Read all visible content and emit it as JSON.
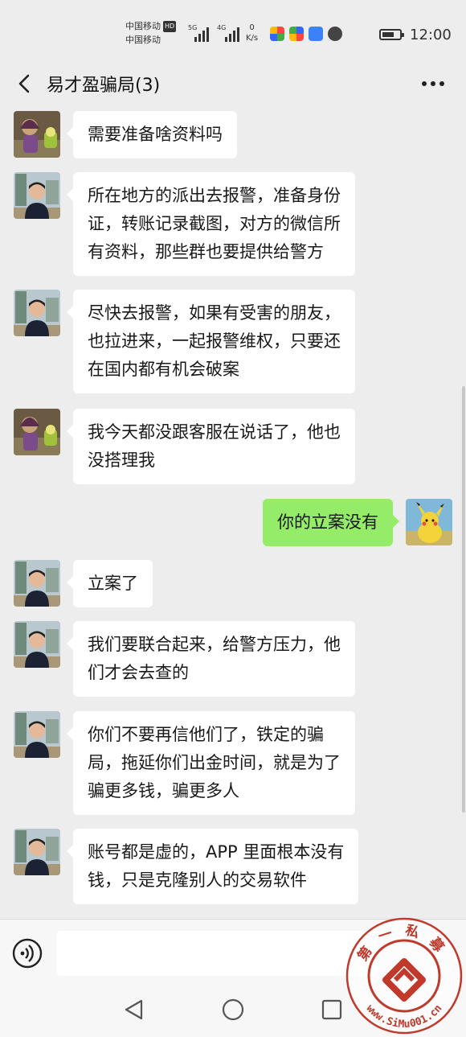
{
  "status": {
    "carrier1": "中国移动",
    "carrier1_badge": "HD",
    "carrier2": "中国移动",
    "net1": "5G",
    "net2": "4G",
    "speed_value": "0",
    "speed_unit": "K/s",
    "battery_level": 0.7,
    "time": "12:00"
  },
  "header": {
    "title": "易才盈骗局(3)",
    "back_icon": "chevron-left-icon",
    "more_icon": "more-dots-icon"
  },
  "messages": [
    {
      "side": "left",
      "avatar": "avatar-woman",
      "lines": [
        "需要准备啥资料吗"
      ]
    },
    {
      "side": "left",
      "avatar": "avatar-man",
      "lines": [
        "所在地方的派出去报警，准备身份",
        "证，转账记录截图，对方的微信所",
        "有资料，那些群也要提供给警方"
      ]
    },
    {
      "side": "left",
      "avatar": "avatar-man",
      "lines": [
        "尽快去报警，如果有受害的朋友，",
        "也拉进来，一起报警维权，只要还",
        "在国内都有机会破案"
      ]
    },
    {
      "side": "left",
      "avatar": "avatar-woman",
      "lines": [
        "我今天都没跟客服在说话了，他也",
        "没搭理我"
      ]
    },
    {
      "side": "right",
      "avatar": "avatar-pikachu",
      "lines": [
        "你的立案没有"
      ]
    },
    {
      "side": "left",
      "avatar": "avatar-man",
      "lines": [
        "立案了"
      ]
    },
    {
      "side": "left",
      "avatar": "avatar-man",
      "lines": [
        "我们要联合起来，给警方压力，他",
        "们才会去查的"
      ]
    },
    {
      "side": "left",
      "avatar": "avatar-man",
      "lines": [
        "你们不要再信他们了，铁定的骗",
        "局，拖延你们出金时间，就是为了",
        "骗更多钱，骗更多人"
      ]
    },
    {
      "side": "left",
      "avatar": "avatar-man",
      "lines": [
        "账号都是虚的，APP 里面根本没有",
        "钱，只是克隆别人的交易软件"
      ]
    }
  ],
  "input": {
    "voice_icon": "voice-icon",
    "text_value": ""
  },
  "nav": {
    "back_icon": "nav-back-icon",
    "home_icon": "nav-home-icon",
    "recents_icon": "nav-recents-icon"
  },
  "watermark": {
    "top_text": "第一私募",
    "bottom_text": "www.SiMu001.cn"
  },
  "colors": {
    "background": "#ededed",
    "bubble_left": "#ffffff",
    "bubble_right": "#95ec69",
    "stamp_red": "#c0392b"
  }
}
